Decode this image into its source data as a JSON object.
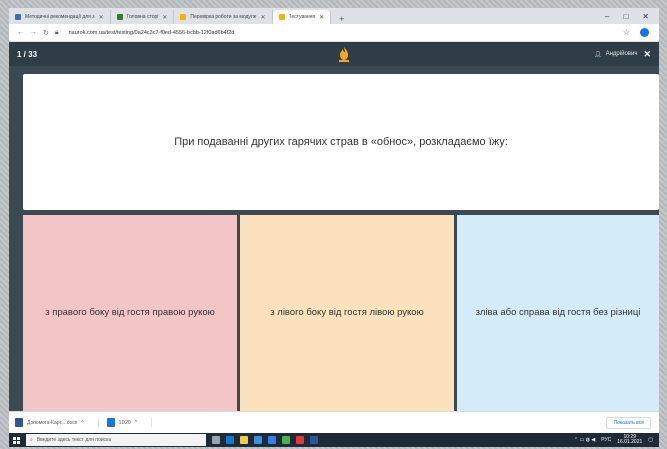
{
  "browser": {
    "tabs": [
      {
        "label": "Методичні рекомендації для з",
        "active": false,
        "color": "#3c6fb5"
      },
      {
        "label": "Головна сторі",
        "active": false,
        "color": "#2e7d32"
      },
      {
        "label": "Перевірка роботи за модуле",
        "active": false,
        "color": "#f4b400"
      },
      {
        "label": "Тестування",
        "active": true,
        "color": "#f4b400"
      }
    ],
    "new_tab": "+",
    "url": "naurok.com.ua/test/testing/0a24c3c7-f0ed-4556-bcbb-12f0ad6b4f2d",
    "window_controls": [
      "–",
      "□",
      "✕"
    ]
  },
  "quiz": {
    "counter": "1 / 33",
    "user": "Андрійович",
    "close": "✕",
    "question": "При подаванні других гарячих страв в «обнос», розкладаємо їжу:",
    "answers": [
      "з правого боку від гостя правою рукою",
      "з лівого боку від гостя лівою рукою",
      "зліва або справа від гостя без різниці"
    ],
    "answer_colors": [
      "#f2c6c7",
      "#fce1bd",
      "#d4ecfa"
    ]
  },
  "downloads": {
    "items": [
      {
        "label": "Допомога-Карт....docx",
        "menu": "^"
      },
      {
        "label": "1D20",
        "menu": "^"
      }
    ],
    "show_all": "Показать все"
  },
  "taskbar": {
    "search_placeholder": "Введите здесь текст для поиска",
    "clock_time": "10:29",
    "clock_date": "16.01.2021",
    "lang": "РУС"
  }
}
